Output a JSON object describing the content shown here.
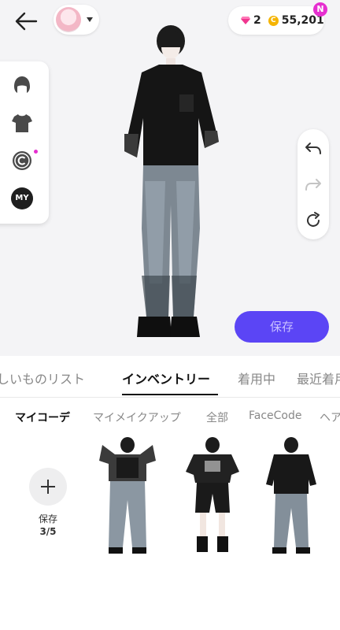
{
  "header": {
    "back_icon": "arrow-left-icon",
    "avatar_selector_icon": "chevron-down-icon",
    "gems": "2",
    "coins": "55,201",
    "notification_badge": "N",
    "colors": {
      "badge": "#e62fd0",
      "coin": "#f5b400",
      "gem": "#f0368f"
    }
  },
  "side_menu": {
    "items": [
      {
        "icon": "hair-icon"
      },
      {
        "icon": "shirt-icon"
      },
      {
        "icon": "copyright-icon",
        "has_dot": true
      },
      {
        "icon": "my-icon",
        "label": "MY"
      }
    ]
  },
  "history": {
    "undo_icon": "undo-icon",
    "redo_icon": "redo-icon",
    "reset_icon": "refresh-icon"
  },
  "save_button": {
    "label": "保存",
    "color": "#5b45f5"
  },
  "tabs": [
    {
      "label": "ほしいものリスト"
    },
    {
      "label": "インベントリー",
      "active": true
    },
    {
      "label": "着用中"
    },
    {
      "label": "最近着用"
    }
  ],
  "subtabs": [
    {
      "label": "マイコーデ",
      "active": true
    },
    {
      "label": "マイメイクアップ"
    },
    {
      "label": "全部"
    },
    {
      "label": "FaceCode"
    },
    {
      "label": "ヘア"
    }
  ],
  "slots": {
    "add_label": "保存",
    "count": "3/5"
  }
}
